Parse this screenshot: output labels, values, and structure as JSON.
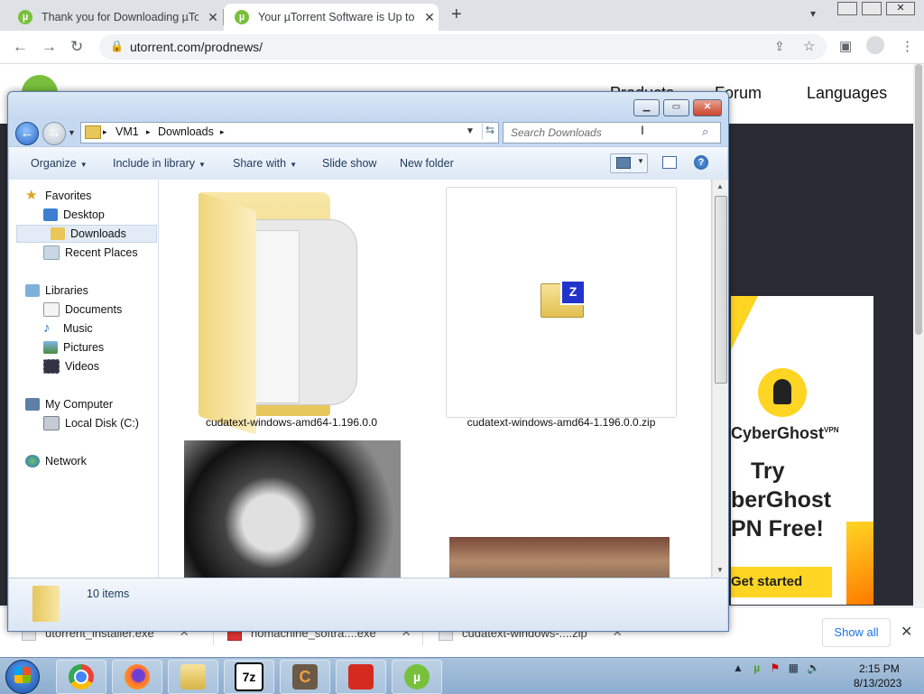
{
  "browser": {
    "tabs": [
      {
        "title": "Thank you for Downloading µTor",
        "active": false
      },
      {
        "title": "Your µTorrent Software is Up to-D",
        "active": true
      }
    ],
    "new_tab_label": "+",
    "url": "utorrent.com/prodnews/"
  },
  "website": {
    "nav_links": [
      "Products",
      "Forum",
      "Languages"
    ],
    "ad": {
      "brand": "CyberGhost",
      "brand_sup": "VPN",
      "headline_1": "Try",
      "headline_2": "berGhost",
      "headline_3": "PN Free!",
      "cta": "Get started",
      "accent_color": "#ffd524"
    }
  },
  "downloads_shelf": {
    "items": [
      {
        "name": "utorrent_installer.exe"
      },
      {
        "name": "nomachine_softra....exe"
      },
      {
        "name": "cudatext-windows-....zip"
      }
    ],
    "show_all": "Show all"
  },
  "explorer": {
    "breadcrumbs": [
      "VM1",
      "Downloads"
    ],
    "search_placeholder": "Search Downloads",
    "commands": [
      "Organize",
      "Include in library",
      "Share with",
      "Slide show",
      "New folder"
    ],
    "nav": {
      "favorites": {
        "label": "Favorites",
        "items": [
          "Desktop",
          "Downloads",
          "Recent Places"
        ],
        "selected": "Downloads"
      },
      "libraries": {
        "label": "Libraries",
        "items": [
          "Documents",
          "Music",
          "Pictures",
          "Videos"
        ]
      },
      "computer": {
        "label": "My Computer",
        "items": [
          "Local Disk (C:)"
        ]
      },
      "network": {
        "label": "Network"
      }
    },
    "files": [
      {
        "name": "cudatext-windows-amd64-1.196.0.0",
        "type": "folder"
      },
      {
        "name": "cudatext-windows-amd64-1.196.0.0.zip",
        "type": "zip"
      },
      {
        "name": "",
        "type": "image"
      },
      {
        "name": "",
        "type": "image"
      }
    ],
    "item_count": "10 items",
    "zip_badge": "Z"
  },
  "taskbar": {
    "apps": [
      "chrome-icon",
      "firefox-icon",
      "explorer-icon",
      "7zip-icon",
      "cudatext-icon",
      "nomachine-icon",
      "utorrent-icon"
    ],
    "app_7z_label": "7z",
    "app_c_label": "C",
    "time": "2:15 PM",
    "date": "8/13/2023"
  }
}
